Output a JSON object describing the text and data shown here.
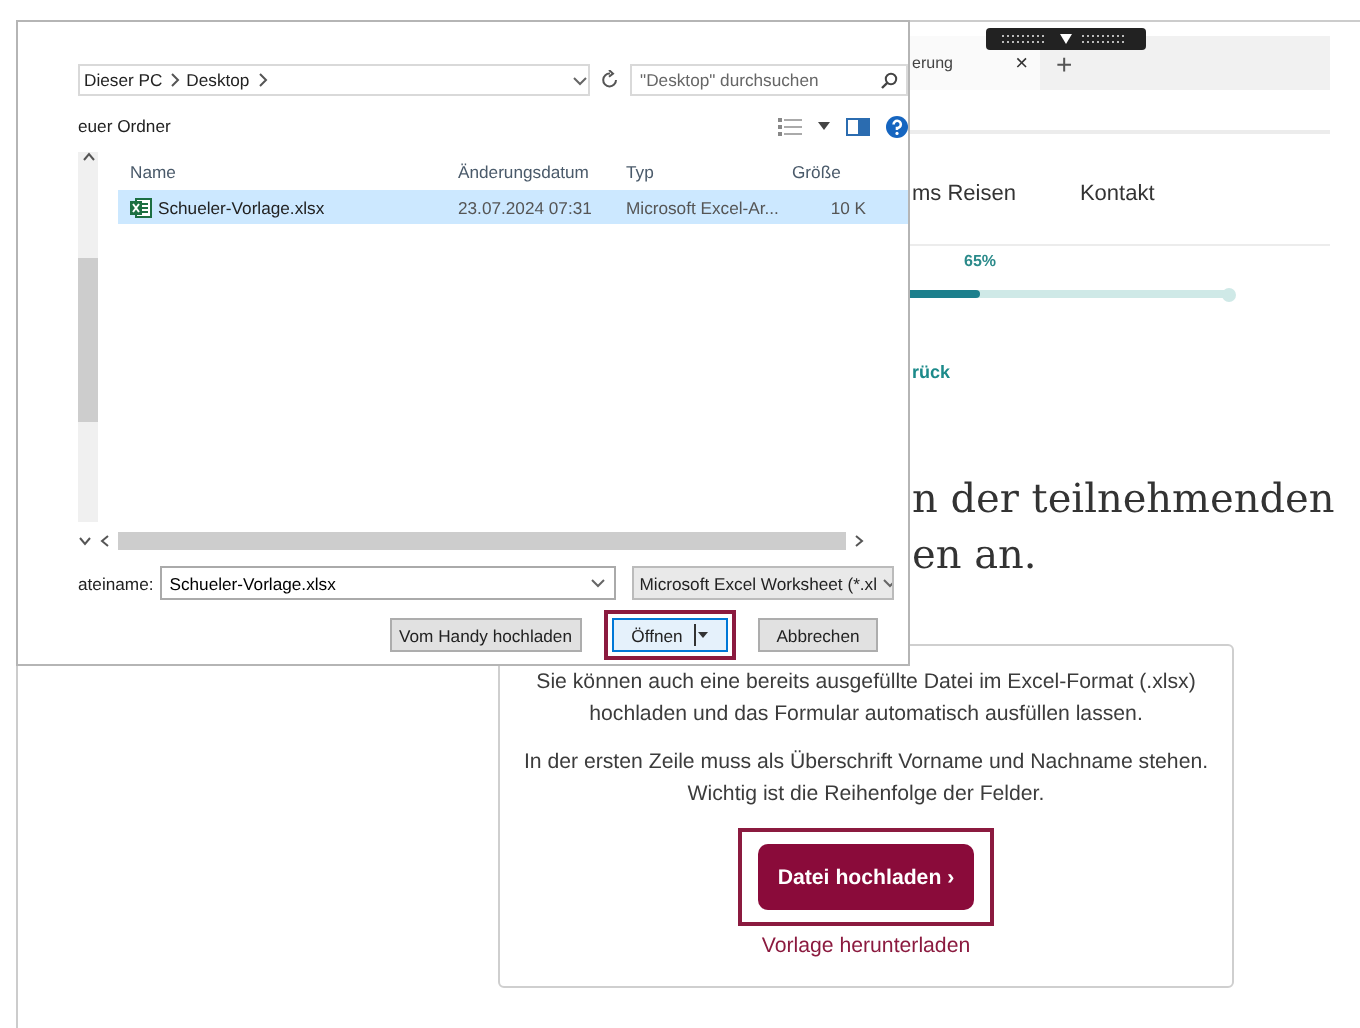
{
  "browser": {
    "tab": {
      "title": "erung",
      "close": "×"
    },
    "new_tab": "+"
  },
  "nav": [
    {
      "label": "ms Reisen"
    },
    {
      "label": "Kontakt"
    }
  ],
  "progress": {
    "label": "65%",
    "level": 0.65
  },
  "back_link": "rück",
  "heading_lines": [
    "n der teilnehmenden",
    "en an."
  ],
  "upload_card": {
    "paragraphs": [
      "Sie können auch eine bereits ausgefüllte Datei im Excel-Format (.xlsx) hochladen und das Formular automatisch ausfüllen lassen.",
      "In der ersten Zeile muss als Überschrift Vorname und Nachname stehen. Wichtig ist die Reihenfolge der Felder."
    ],
    "button": {
      "label": "Datei hochladen ›",
      "highlighted": true
    },
    "link": "Vorlage herunterladen"
  },
  "dialog": {
    "breadcrumb": [
      "Dieser PC",
      "Desktop"
    ],
    "search": {
      "placeholder": "\"Desktop\" durchsuchen"
    },
    "new_folder": "euer Ordner",
    "columns": [
      "Name",
      "Änderungsdatum",
      "Typ",
      "Größe"
    ],
    "files": [
      {
        "name": "Schueler-Vorlage.xlsx",
        "modified": "23.07.2024 07:31",
        "type": "Microsoft Excel-Ar...",
        "size": "10 K",
        "selected": true
      }
    ],
    "filename_label": "ateiname:",
    "filename": "Schueler-Vorlage.xlsx",
    "filetype": "Microsoft Excel Worksheet (*.xl",
    "buttons": [
      {
        "label": "Vom Handy hochladen",
        "kind": "plain",
        "default": false,
        "highlighted": false
      },
      {
        "label": "Öffnen",
        "kind": "split",
        "default": true,
        "highlighted": true
      },
      {
        "label": "Abbrechen",
        "kind": "plain",
        "default": false,
        "highlighted": false
      }
    ]
  }
}
